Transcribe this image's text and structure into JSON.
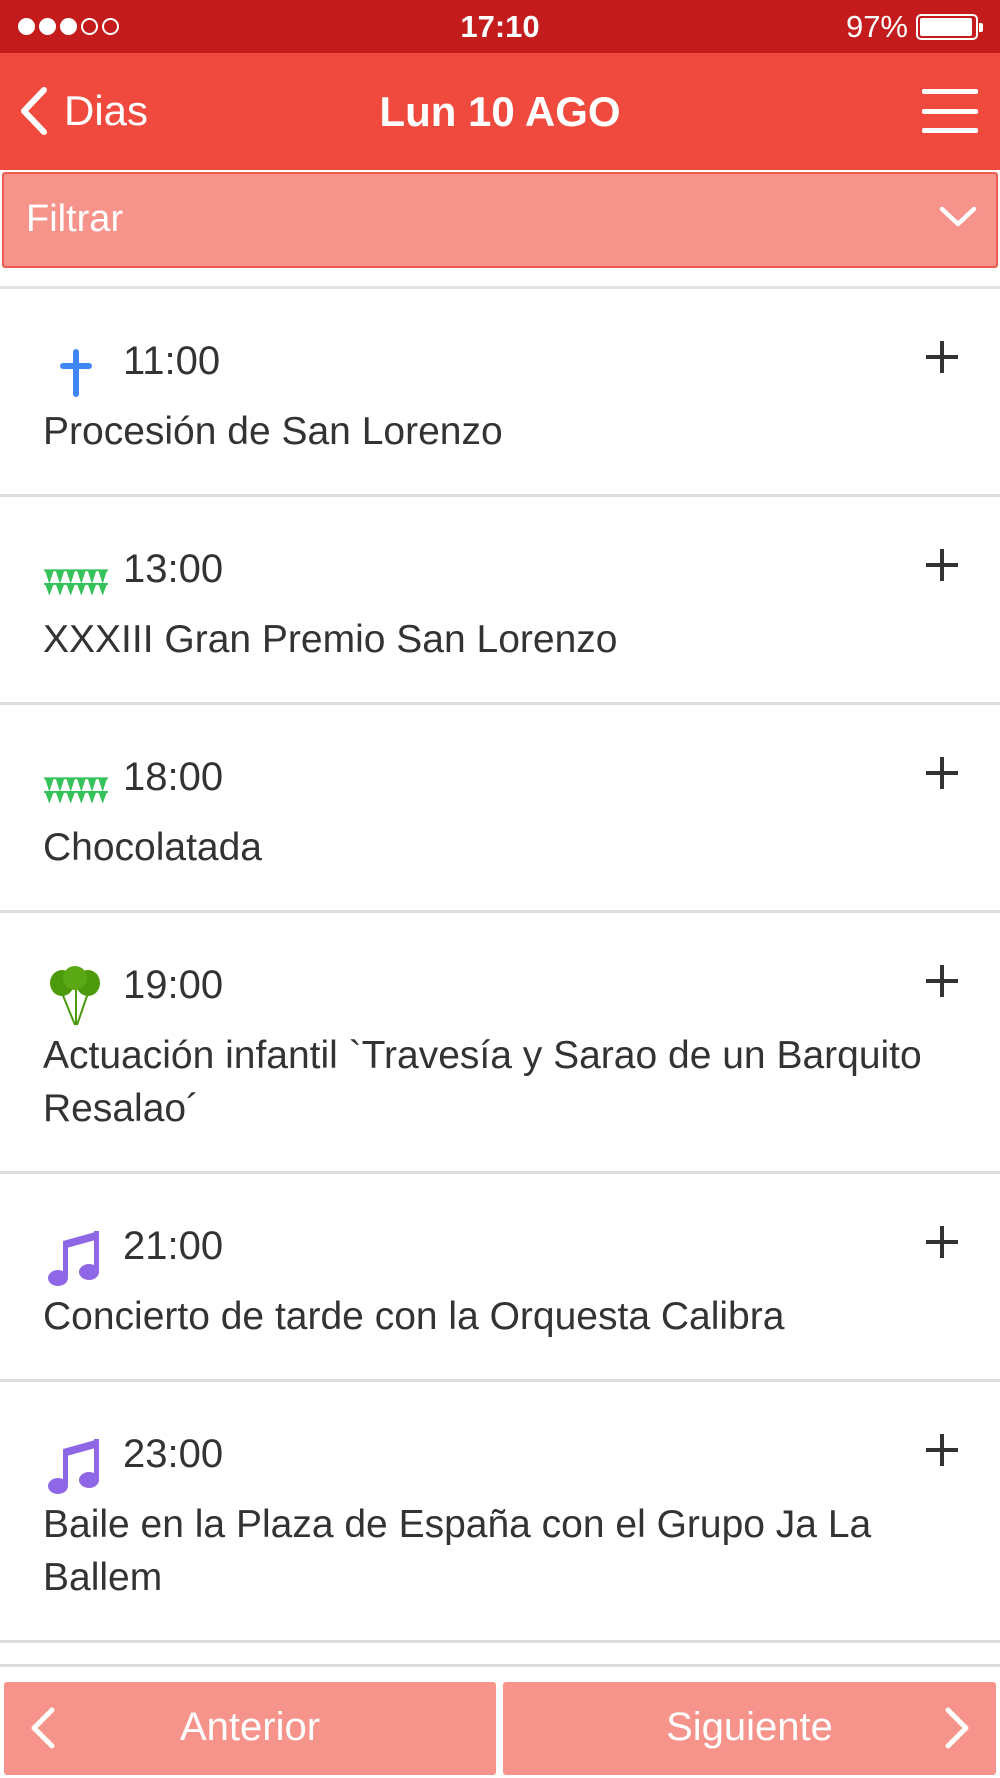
{
  "status_bar": {
    "signal_dots_filled": 3,
    "signal_dots_total": 5,
    "time": "17:10",
    "battery_percent": "97%",
    "battery_level": 0.97
  },
  "nav": {
    "back_label": "Dias",
    "title": "Lun 10 AGO",
    "back_icon": "chevron-left-icon",
    "menu_icon": "hamburger-menu-icon"
  },
  "filter": {
    "label": "Filtrar",
    "icon": "chevron-down-icon"
  },
  "events": [
    {
      "time": "11:00",
      "title": "Procesión de San Lorenzo",
      "icon": "cross-icon",
      "add_label": "+"
    },
    {
      "time": "13:00",
      "title": "XXXIII Gran Premio San Lorenzo",
      "icon": "bunting-icon",
      "add_label": "+"
    },
    {
      "time": "18:00",
      "title": "Chocolatada",
      "icon": "bunting-icon",
      "add_label": "+"
    },
    {
      "time": "19:00",
      "title": "Actuación infantil `Travesía y Sarao de un Barquito Resalao´",
      "icon": "balloons-icon",
      "add_label": "+"
    },
    {
      "time": "21:00",
      "title": "Concierto de tarde con la Orquesta Calibra",
      "icon": "music-note-icon",
      "add_label": "+"
    },
    {
      "time": "23:00",
      "title": "Baile en la Plaza de España con el Grupo Ja La Ballem",
      "icon": "music-note-icon",
      "add_label": "+"
    }
  ],
  "pager": {
    "prev_label": "Anterior",
    "next_label": "Siguiente"
  },
  "colors": {
    "status_bar": "#c41b1c",
    "nav_bar": "#f0493d",
    "filter_bar": "#f6938b",
    "pager_button": "#f6938b",
    "cross_icon": "#3f86f2",
    "bunting_icon": "#35c25a",
    "balloons_icon": "#4c9a0c",
    "music_icon": "#8e67e6"
  }
}
